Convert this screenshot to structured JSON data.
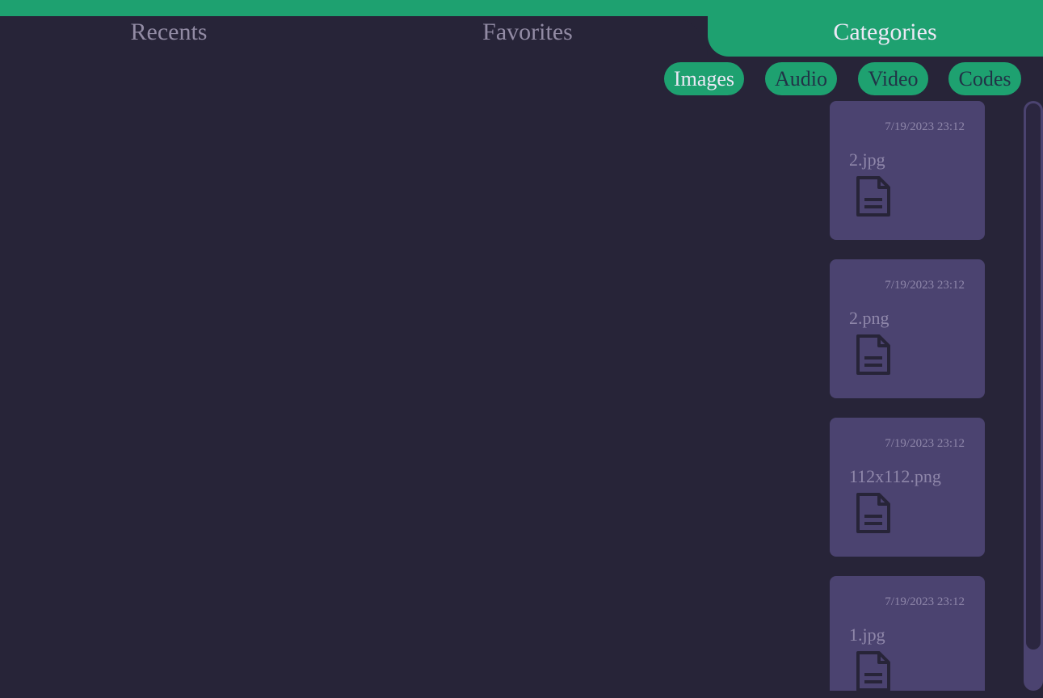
{
  "tabs": {
    "recents": "Recents",
    "favorites": "Favorites",
    "categories": "Categories",
    "active": "categories"
  },
  "filters": {
    "images": "Images",
    "audio": "Audio",
    "video": "Video",
    "codes": "Codes",
    "selected": "images"
  },
  "files": [
    {
      "date": "7/19/2023 23:12",
      "name": "2.jpg",
      "icon": "document-icon"
    },
    {
      "date": "7/19/2023 23:12",
      "name": "2.png",
      "icon": "document-icon"
    },
    {
      "date": "7/19/2023 23:12",
      "name": "112x112.png",
      "icon": "document-icon"
    },
    {
      "date": "7/19/2023 23:12",
      "name": "1.jpg",
      "icon": "document-icon"
    }
  ],
  "colors": {
    "background": "#272438",
    "accent": "#1ea170",
    "card": "#4b4370",
    "muted_text": "#8f87aa"
  }
}
